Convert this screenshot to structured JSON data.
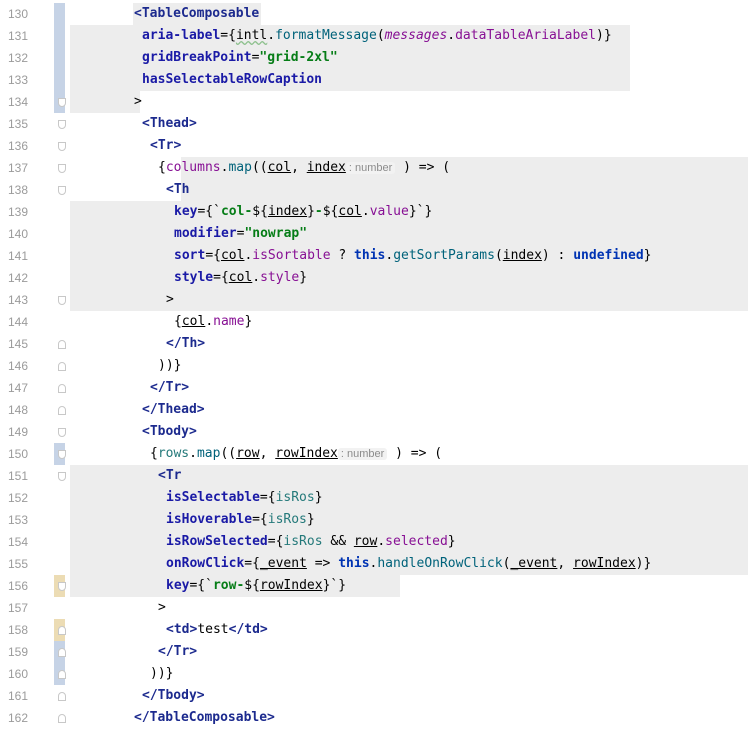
{
  "editor": {
    "lines": [
      {
        "num": "130",
        "indent": 8,
        "tokens": [
          [
            "tag",
            "<TableComposable"
          ]
        ]
      },
      {
        "num": "131",
        "indent": 9,
        "tokens": [
          [
            "attr",
            "aria-label"
          ],
          [
            "plain",
            "={"
          ],
          [
            "wavy",
            "intl"
          ],
          [
            "plain",
            "."
          ],
          [
            "fn",
            "formatMessage"
          ],
          [
            "plain",
            "("
          ],
          [
            "ital",
            "messages"
          ],
          [
            "plain",
            "."
          ],
          [
            "ident",
            "dataTableAriaLabel"
          ],
          [
            "plain",
            ")}"
          ]
        ]
      },
      {
        "num": "132",
        "indent": 9,
        "tokens": [
          [
            "attr",
            "gridBreakPoint"
          ],
          [
            "plain",
            "="
          ],
          [
            "str",
            "\"grid-2xl\""
          ]
        ]
      },
      {
        "num": "133",
        "indent": 9,
        "tokens": [
          [
            "attr",
            "hasSelectableRowCaption"
          ]
        ]
      },
      {
        "num": "134",
        "indent": 8,
        "tokens": [
          [
            "plain",
            ">"
          ]
        ]
      },
      {
        "num": "135",
        "indent": 9,
        "tokens": [
          [
            "tag",
            "<Thead>"
          ]
        ]
      },
      {
        "num": "136",
        "indent": 10,
        "tokens": [
          [
            "tag",
            "<Tr>"
          ]
        ]
      },
      {
        "num": "137",
        "indent": 11,
        "tokens": [
          [
            "plain",
            "{"
          ],
          [
            "ident",
            "columns"
          ],
          [
            "plain",
            "."
          ],
          [
            "fn",
            "map"
          ],
          [
            "plain",
            "(("
          ],
          [
            "param",
            "col"
          ],
          [
            "plain",
            ", "
          ],
          [
            "param",
            "index"
          ],
          [
            "hint",
            ": number"
          ],
          [
            "plain",
            " ) => ("
          ]
        ]
      },
      {
        "num": "138",
        "indent": 12,
        "tokens": [
          [
            "tag",
            "<Th"
          ]
        ]
      },
      {
        "num": "139",
        "indent": 13,
        "tokens": [
          [
            "attr",
            "key"
          ],
          [
            "plain",
            "={`"
          ],
          [
            "str",
            "col-"
          ],
          [
            "plain",
            "${"
          ],
          [
            "param",
            "index"
          ],
          [
            "plain",
            "}"
          ],
          [
            "str",
            "-"
          ],
          [
            "plain",
            "${"
          ],
          [
            "param",
            "col"
          ],
          [
            "plain",
            "."
          ],
          [
            "ident",
            "value"
          ],
          [
            "plain",
            "}`}"
          ]
        ]
      },
      {
        "num": "140",
        "indent": 13,
        "tokens": [
          [
            "attr",
            "modifier"
          ],
          [
            "plain",
            "="
          ],
          [
            "str",
            "\"nowrap\""
          ]
        ]
      },
      {
        "num": "141",
        "indent": 13,
        "tokens": [
          [
            "attr",
            "sort"
          ],
          [
            "plain",
            "={"
          ],
          [
            "param",
            "col"
          ],
          [
            "plain",
            "."
          ],
          [
            "ident",
            "isSortable"
          ],
          [
            "plain",
            " ? "
          ],
          [
            "kw",
            "this"
          ],
          [
            "plain",
            "."
          ],
          [
            "fn",
            "getSortParams"
          ],
          [
            "plain",
            "("
          ],
          [
            "param",
            "index"
          ],
          [
            "plain",
            ") : "
          ],
          [
            "kw",
            "undefined"
          ],
          [
            "plain",
            "}"
          ]
        ]
      },
      {
        "num": "142",
        "indent": 13,
        "tokens": [
          [
            "attr",
            "style"
          ],
          [
            "plain",
            "={"
          ],
          [
            "param",
            "col"
          ],
          [
            "plain",
            "."
          ],
          [
            "ident",
            "style"
          ],
          [
            "plain",
            "}"
          ]
        ]
      },
      {
        "num": "143",
        "indent": 12,
        "tokens": [
          [
            "plain",
            ">"
          ]
        ]
      },
      {
        "num": "144",
        "indent": 13,
        "tokens": [
          [
            "plain",
            "{"
          ],
          [
            "param",
            "col"
          ],
          [
            "plain",
            "."
          ],
          [
            "ident",
            "name"
          ],
          [
            "plain",
            "}"
          ]
        ]
      },
      {
        "num": "145",
        "indent": 12,
        "tokens": [
          [
            "tag",
            "</Th>"
          ]
        ]
      },
      {
        "num": "146",
        "indent": 11,
        "tokens": [
          [
            "plain",
            "))}"
          ]
        ]
      },
      {
        "num": "147",
        "indent": 10,
        "tokens": [
          [
            "tag",
            "</Tr>"
          ]
        ]
      },
      {
        "num": "148",
        "indent": 9,
        "tokens": [
          [
            "tag",
            "</Thead>"
          ]
        ]
      },
      {
        "num": "149",
        "indent": 9,
        "tokens": [
          [
            "tag",
            "<Tbody>"
          ]
        ]
      },
      {
        "num": "150",
        "indent": 10,
        "tokens": [
          [
            "plain",
            "{"
          ],
          [
            "teal",
            "rows"
          ],
          [
            "plain",
            "."
          ],
          [
            "fn",
            "map"
          ],
          [
            "plain",
            "(("
          ],
          [
            "param",
            "row"
          ],
          [
            "plain",
            ", "
          ],
          [
            "param",
            "rowIndex"
          ],
          [
            "hint",
            ": number"
          ],
          [
            "plain",
            " ) => ("
          ]
        ]
      },
      {
        "num": "151",
        "indent": 11,
        "tokens": [
          [
            "tag",
            "<Tr"
          ]
        ]
      },
      {
        "num": "152",
        "indent": 12,
        "tokens": [
          [
            "attr",
            "isSelectable"
          ],
          [
            "plain",
            "={"
          ],
          [
            "teal",
            "isRos"
          ],
          [
            "plain",
            "}"
          ]
        ]
      },
      {
        "num": "153",
        "indent": 12,
        "tokens": [
          [
            "attr",
            "isHoverable"
          ],
          [
            "plain",
            "={"
          ],
          [
            "teal",
            "isRos"
          ],
          [
            "plain",
            "}"
          ]
        ]
      },
      {
        "num": "154",
        "indent": 12,
        "tokens": [
          [
            "attr",
            "isRowSelected"
          ],
          [
            "plain",
            "={"
          ],
          [
            "teal",
            "isRos"
          ],
          [
            "plain",
            " && "
          ],
          [
            "param",
            "row"
          ],
          [
            "plain",
            "."
          ],
          [
            "ident",
            "selected"
          ],
          [
            "plain",
            "}"
          ]
        ]
      },
      {
        "num": "155",
        "indent": 12,
        "tokens": [
          [
            "attr",
            "onRowClick"
          ],
          [
            "plain",
            "={"
          ],
          [
            "param",
            "_event"
          ],
          [
            "plain",
            " => "
          ],
          [
            "kw",
            "this"
          ],
          [
            "plain",
            "."
          ],
          [
            "fn",
            "handleOnRowClick"
          ],
          [
            "plain",
            "("
          ],
          [
            "param",
            "_event"
          ],
          [
            "plain",
            ", "
          ],
          [
            "param",
            "rowIndex"
          ],
          [
            "plain",
            ")}"
          ]
        ]
      },
      {
        "num": "156",
        "indent": 12,
        "tokens": [
          [
            "attr",
            "key"
          ],
          [
            "plain",
            "={`"
          ],
          [
            "str",
            "row-"
          ],
          [
            "plain",
            "${"
          ],
          [
            "param",
            "rowIndex"
          ],
          [
            "plain",
            "}`}"
          ]
        ]
      },
      {
        "num": "157",
        "indent": 11,
        "tokens": [
          [
            "plain",
            ">"
          ]
        ]
      },
      {
        "num": "158",
        "indent": 12,
        "tokens": [
          [
            "tag",
            "<td>"
          ],
          [
            "plain",
            "test"
          ],
          [
            "tag",
            "</td>"
          ]
        ]
      },
      {
        "num": "159",
        "indent": 11,
        "tokens": [
          [
            "tag",
            "</Tr>"
          ]
        ]
      },
      {
        "num": "160",
        "indent": 10,
        "tokens": [
          [
            "plain",
            "))}"
          ]
        ]
      },
      {
        "num": "161",
        "indent": 9,
        "tokens": [
          [
            "tag",
            "</Tbody>"
          ]
        ]
      },
      {
        "num": "162",
        "indent": 8,
        "tokens": [
          [
            "tag",
            "</TableComposable>"
          ]
        ]
      }
    ],
    "colors": {
      "background": "#ffffff",
      "highlight": "#ededed",
      "vcs_modified": "#c6d3e6",
      "vcs_changed": "#ecdcb4"
    }
  }
}
